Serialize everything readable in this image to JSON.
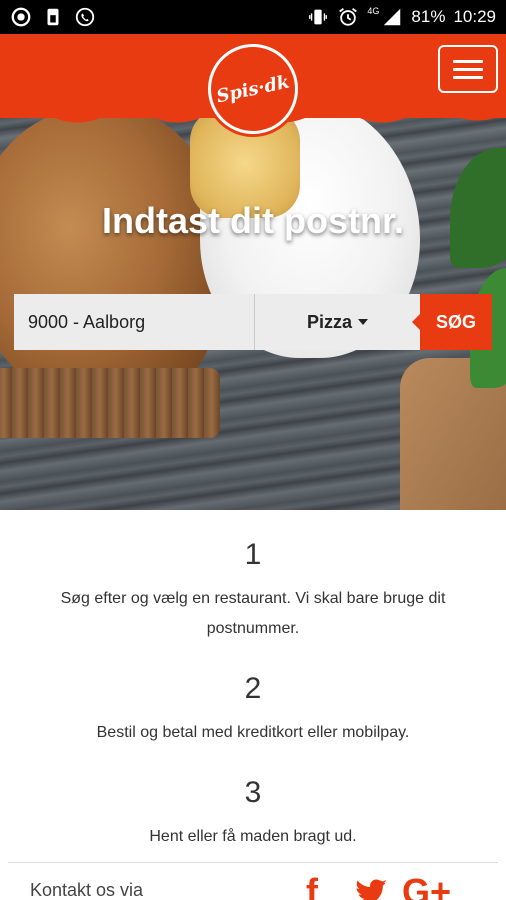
{
  "status_bar": {
    "battery": "81%",
    "time": "10:29",
    "network": "4G",
    "left_icons": [
      "record-icon",
      "sim-icon",
      "whatsapp-icon"
    ],
    "right_icons": [
      "vibrate-icon",
      "alarm-icon",
      "signal-icon"
    ]
  },
  "header": {
    "logo_text": "Spis·dk",
    "menu_icon": "hamburger-icon",
    "brand_color": "#e93b12"
  },
  "hero": {
    "title": "Indtast dit postnr.",
    "postal_value": "9000 - Aalborg",
    "category_value": "Pizza",
    "search_label": "SØG"
  },
  "steps": [
    {
      "number": "1",
      "text": "Søg efter og vælg en restaurant. Vi skal bare bruge dit postnummer."
    },
    {
      "number": "2",
      "text": "Bestil og betal med kreditkort eller mobilpay."
    },
    {
      "number": "3",
      "text": "Hent eller få maden bragt ud."
    }
  ],
  "footer": {
    "text": "Kontakt os via",
    "social": [
      "f",
      "t",
      "G+"
    ]
  }
}
